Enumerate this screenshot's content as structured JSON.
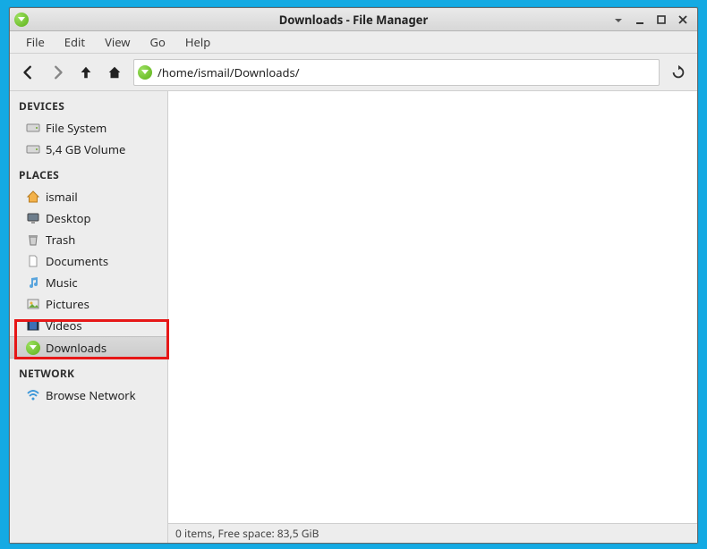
{
  "window": {
    "title": "Downloads - File Manager"
  },
  "menubar": [
    "File",
    "Edit",
    "View",
    "Go",
    "Help"
  ],
  "toolbar": {
    "path": "/home/ismail/Downloads/"
  },
  "sidebar": {
    "headings": {
      "devices": "DEVICES",
      "places": "PLACES",
      "network": "NETWORK"
    },
    "devices": [
      {
        "label": "File System",
        "icon": "disk"
      },
      {
        "label": "5,4 GB Volume",
        "icon": "disk"
      }
    ],
    "places": [
      {
        "label": "ismail",
        "icon": "home"
      },
      {
        "label": "Desktop",
        "icon": "desktop"
      },
      {
        "label": "Trash",
        "icon": "trash"
      },
      {
        "label": "Documents",
        "icon": "doc"
      },
      {
        "label": "Music",
        "icon": "music"
      },
      {
        "label": "Pictures",
        "icon": "pictures"
      },
      {
        "label": "Videos",
        "icon": "videos"
      },
      {
        "label": "Downloads",
        "icon": "download",
        "selected": true,
        "highlighted": true
      }
    ],
    "network": [
      {
        "label": "Browse Network",
        "icon": "wifi"
      }
    ]
  },
  "statusbar": {
    "text": "0 items, Free space: 83,5 GiB"
  }
}
